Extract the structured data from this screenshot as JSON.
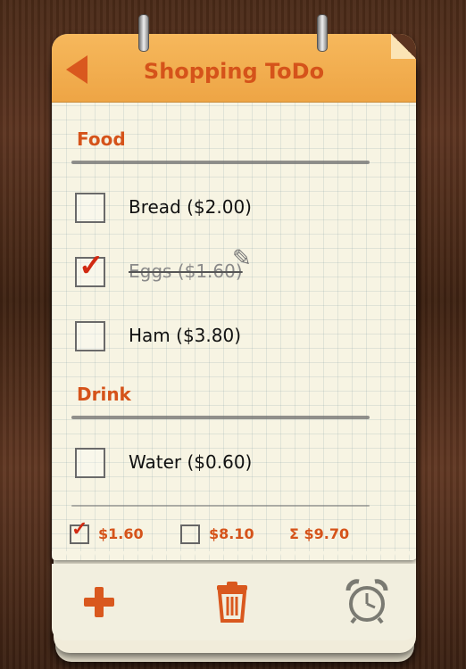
{
  "header": {
    "title": "Shopping ToDo"
  },
  "sections": [
    {
      "title": "Food",
      "items": [
        {
          "label": "Bread ($2.00)",
          "checked": false
        },
        {
          "label": "Eggs ($1.60)",
          "checked": true
        },
        {
          "label": "Ham ($3.80)",
          "checked": false
        }
      ]
    },
    {
      "title": "Drink",
      "items": [
        {
          "label": "Water ($0.60)",
          "checked": false
        }
      ]
    }
  ],
  "summary": {
    "checked_total": "$1.60",
    "unchecked_total": "$8.10",
    "grand_total": "Σ $9.70"
  },
  "icons": {
    "back": "back-arrow-icon",
    "edit": "pencil-icon",
    "add": "plus-icon",
    "delete": "trash-icon",
    "alarm": "alarm-clock-icon"
  },
  "colors": {
    "accent": "#d5531a",
    "check": "#d12a12",
    "header": "#f0a84b"
  }
}
